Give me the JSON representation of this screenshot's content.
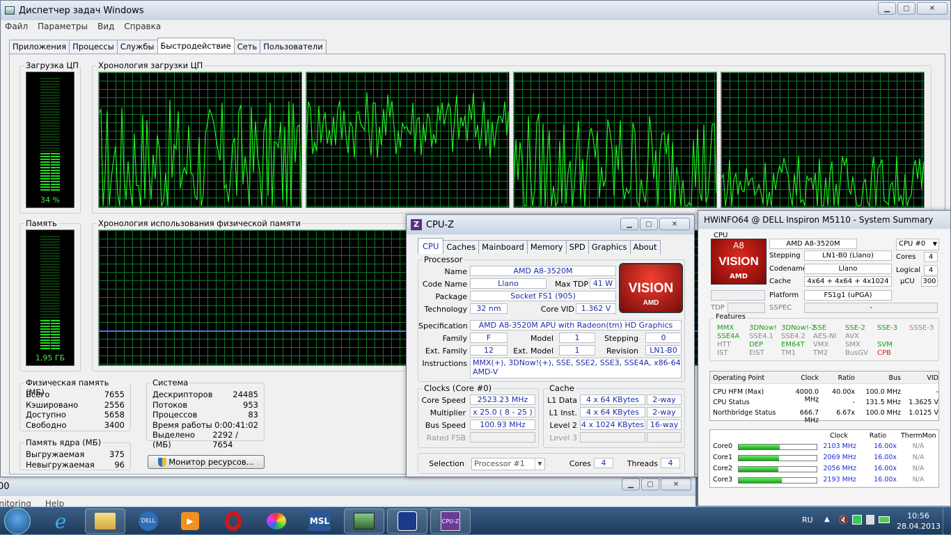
{
  "taskmgr": {
    "title": "Диспетчер задач Windows",
    "menu": [
      "Файл",
      "Параметры",
      "Вид",
      "Справка"
    ],
    "tabs": [
      "Приложения",
      "Процессы",
      "Службы",
      "Быстродействие",
      "Сеть",
      "Пользователи"
    ],
    "active_tab": 3,
    "cpu_label": "Загрузка ЦП",
    "cpu_value": "34 %",
    "cpu_percent": 34,
    "cpu_history_label": "Хронология загрузки ЦП",
    "mem_label": "Память",
    "mem_value": "1,95 ГБ",
    "mem_percent": 26,
    "mem_history_label": "Хронология использования физической памяти",
    "physmem": {
      "label": "Физическая память (МБ)",
      "rows": [
        [
          "Всего",
          "7655"
        ],
        [
          "Кэшировано",
          "2556"
        ],
        [
          "Доступно",
          "5658"
        ],
        [
          "Свободно",
          "3400"
        ]
      ]
    },
    "kernel": {
      "label": "Память ядра (МБ)",
      "rows": [
        [
          "Выгружаемая",
          "375"
        ],
        [
          "Невыгружаемая",
          "96"
        ]
      ]
    },
    "system": {
      "label": "Система",
      "rows": [
        [
          "Дескрипторов",
          "24485"
        ],
        [
          "Потоков",
          "953"
        ],
        [
          "Процессов",
          "83"
        ],
        [
          "Время работы",
          "0:00:41:02"
        ],
        [
          "Выделено (МБ)",
          "2292 / 7654"
        ]
      ]
    },
    "resmon_button": "Монитор ресурсов..."
  },
  "bg_window": {
    "title_fragment": "00",
    "menu_fragment": [
      "onitoring",
      "Help"
    ]
  },
  "cpuz": {
    "title": "CPU-Z",
    "tabs": [
      "CPU",
      "Caches",
      "Mainboard",
      "Memory",
      "SPD",
      "Graphics",
      "About"
    ],
    "processor_label": "Processor",
    "name_label": "Name",
    "name": "AMD A8-3520M",
    "codename_label": "Code Name",
    "codename": "Llano",
    "maxtdp_label": "Max TDP",
    "maxtdp": "41 W",
    "package_label": "Package",
    "package": "Socket FS1 (905)",
    "tech_label": "Technology",
    "tech": "32 nm",
    "corevid_label": "Core VID",
    "corevid": "1.362 V",
    "spec_label": "Specification",
    "spec": "AMD A8-3520M APU with Radeon(tm) HD Graphics",
    "family_label": "Family",
    "family": "F",
    "model_label": "Model",
    "model": "1",
    "stepping_label": "Stepping",
    "stepping": "0",
    "extfamily_label": "Ext. Family",
    "extfamily": "12",
    "extmodel_label": "Ext. Model",
    "extmodel": "1",
    "revision_label": "Revision",
    "revision": "LN1-B0",
    "instr_label": "Instructions",
    "instr1": "MMX(+), 3DNow!(+), SSE, SSE2, SSE3, SSE4A, x86-64,",
    "instr2": "AMD-V",
    "clocks_label": "Clocks (Core #0)",
    "corespeed_label": "Core Speed",
    "corespeed": "2523.23 MHz",
    "mult_label": "Multiplier",
    "mult": "x 25.0 ( 8 - 25 )",
    "bus_label": "Bus Speed",
    "bus": "100.93 MHz",
    "fsb_label": "Rated FSB",
    "fsb": "",
    "cache_label": "Cache",
    "l1d_label": "L1 Data",
    "l1d": "4 x 64 KBytes",
    "l1d_way": "2-way",
    "l1i_label": "L1 Inst.",
    "l1i": "4 x 64 KBytes",
    "l1i_way": "2-way",
    "l2_label": "Level 2",
    "l2": "4 x 1024 KBytes",
    "l2_way": "16-way",
    "l3_label": "Level 3",
    "selection_label": "Selection",
    "selection": "Processor #1",
    "cores_label": "Cores",
    "cores": "4",
    "threads_label": "Threads",
    "threads": "4",
    "logo_text": "VISION",
    "logo_brand": "AMD"
  },
  "hwinfo": {
    "title": "HWiNFO64 @ DELL Inspiron M5110 - System Summary",
    "cpu_label": "CPU",
    "logo_top": "A8",
    "logo_mid": "VISION",
    "logo_brand": "AMD",
    "model": "AMD A8-3520M",
    "cpu_select": "CPU #0",
    "stepping_label": "Stepping",
    "stepping": "LN1-B0 (Llano)",
    "cores_label": "Cores",
    "cores": "4",
    "codename_label": "Codename",
    "codename": "Llano",
    "logical_label": "Logical",
    "logical": "4",
    "cache_label": "Cache",
    "cache": "4x64 + 4x64 + 4x1024",
    "ucu_label": "µCU",
    "ucu": "300",
    "platform_label": "Platform",
    "platform": "FS1g1 (uPGA)",
    "tdp_label": "TDP",
    "sspec_label": "SSPEC",
    "sspec": "-",
    "features_label": "Features",
    "features": [
      [
        "MMX",
        "on"
      ],
      [
        "3DNow!",
        "on"
      ],
      [
        "3DNow!-2",
        "on"
      ],
      [
        "SSE",
        "on"
      ],
      [
        "SSE-2",
        "on"
      ],
      [
        "SSE-3",
        "on"
      ],
      [
        "SSSE-3",
        "off"
      ],
      [
        "SSE4A",
        "on"
      ],
      [
        "SSE4.1",
        "off"
      ],
      [
        "SSE4.2",
        "off"
      ],
      [
        "AES-NI",
        "off"
      ],
      [
        "AVX",
        "off"
      ],
      [
        "HTT",
        "off"
      ],
      [
        "DEP",
        "on"
      ],
      [
        "EM64T",
        "on"
      ],
      [
        "VMX",
        "off"
      ],
      [
        "SMX",
        "off"
      ],
      [
        "SVM",
        "on"
      ],
      [
        "IST",
        "off"
      ],
      [
        "EIST",
        "off"
      ],
      [
        "TM1",
        "off"
      ],
      [
        "TM2",
        "off"
      ],
      [
        "BusGV",
        "off"
      ],
      [
        "CPB",
        "red"
      ]
    ],
    "op_headers": [
      "Operating Point",
      "Clock",
      "Ratio",
      "Bus",
      "VID"
    ],
    "op_rows": [
      [
        "CPU HFM (Max)",
        "4000.0 MHz",
        "40.00x",
        "100.0 MHz",
        "-"
      ],
      [
        "CPU Status",
        "-",
        "-",
        "131.5 MHz",
        "1.3625 V"
      ],
      [
        "Northbridge Status",
        "666.7 MHz",
        "6.67x",
        "100.0 MHz",
        "1.0125 V"
      ]
    ],
    "core_headers": [
      "Clock",
      "Ratio",
      "ThermMon"
    ],
    "cores_rows": [
      [
        "Core0",
        "2103 MHz",
        "16.00x",
        "N/A",
        0.53
      ],
      [
        "Core1",
        "2069 MHz",
        "16.00x",
        "N/A",
        0.52
      ],
      [
        "Core2",
        "2056 MHz",
        "16.00x",
        "N/A",
        0.51
      ],
      [
        "Core3",
        "2193 MHz",
        "16.00x",
        "N/A",
        0.55
      ]
    ]
  },
  "tray": {
    "lang": "RU",
    "time": "10:56",
    "date": "28.04.2013"
  },
  "taskbar_icons": [
    "start-orb-icon",
    "ie-icon",
    "explorer-icon",
    "dell-icon",
    "media-player-icon",
    "opera-icon",
    "paint-icon",
    "msl-icon",
    "hwinfo-icon",
    "bench-icon",
    "cpuz-icon"
  ]
}
